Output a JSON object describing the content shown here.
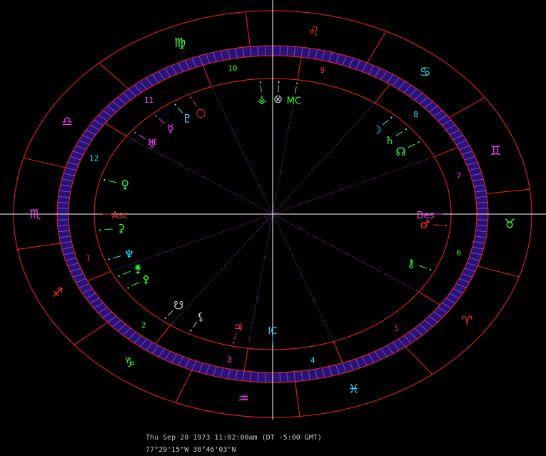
{
  "colors": {
    "background": "#000000",
    "ring": "#ff2020",
    "band": "#7a3cff",
    "axis": "#ffffff",
    "cusp": "#b030d0",
    "fire": "#ff3030",
    "earth": "#30ff30",
    "air": "#ff40ff",
    "water": "#30e0ff",
    "neutral": "#c0c0c0"
  },
  "zodiac": [
    {
      "name": "scorpio",
      "glyph": "♏",
      "angle": 180,
      "color": "#ff40ff"
    },
    {
      "name": "libra",
      "glyph": "♎",
      "angle": 150,
      "color": "#ff40ff"
    },
    {
      "name": "virgo",
      "glyph": "♍",
      "angle": 113,
      "color": "#30ff30"
    },
    {
      "name": "leo",
      "glyph": "♌",
      "angle": 80,
      "color": "#ff3030"
    },
    {
      "name": "cancer",
      "glyph": "♋",
      "angle": 50,
      "color": "#30e0ff"
    },
    {
      "name": "gemini",
      "glyph": "♊",
      "angle": 20,
      "color": "#ff40ff"
    },
    {
      "name": "taurus",
      "glyph": "♉",
      "angle": -3,
      "color": "#30ff30"
    },
    {
      "name": "aries",
      "glyph": "♈",
      "angle": -35,
      "color": "#ff3030"
    },
    {
      "name": "pisces",
      "glyph": "♓",
      "angle": -70,
      "color": "#30e0ff"
    },
    {
      "name": "aquarius",
      "glyph": "♒",
      "angle": -97,
      "color": "#ff40ff"
    },
    {
      "name": "capricorn",
      "glyph": "♑",
      "angle": -127,
      "color": "#30ff30"
    },
    {
      "name": "sagittarius",
      "glyph": "♐",
      "angle": -155,
      "color": "#ff3030"
    }
  ],
  "sign_boundaries": [
    164,
    132,
    96,
    64,
    35,
    7,
    -18,
    -52,
    -84,
    -112,
    -140,
    -170
  ],
  "house_cusps": [
    180,
    145,
    110,
    82,
    55,
    25,
    0,
    -35,
    -70,
    -98,
    -125,
    -155
  ],
  "house_numbers": [
    {
      "label": "1",
      "angle": -163,
      "color": "#ff3030"
    },
    {
      "label": "2",
      "angle": -132,
      "color": "#30ff30"
    },
    {
      "label": "3",
      "angle": -103,
      "color": "#ff40ff"
    },
    {
      "label": "4",
      "angle": -78,
      "color": "#30e0ff"
    },
    {
      "label": "5",
      "angle": -50,
      "color": "#ff3030"
    },
    {
      "label": "6",
      "angle": -15,
      "color": "#30ff30"
    },
    {
      "label": "7",
      "angle": 15,
      "color": "#ff40ff"
    },
    {
      "label": "8",
      "angle": 42,
      "color": "#30e0ff"
    },
    {
      "label": "9",
      "angle": 75,
      "color": "#ff3030"
    },
    {
      "label": "10",
      "angle": 102,
      "color": "#30ff30"
    },
    {
      "label": "11",
      "angle": 130,
      "color": "#ff40ff"
    },
    {
      "label": "12",
      "angle": 158,
      "color": "#30e0ff"
    }
  ],
  "points": [
    {
      "name": "mc",
      "glyph": "MC",
      "angle": 82,
      "color": "#30ff30"
    },
    {
      "name": "sun",
      "glyph": "⊗",
      "angle": 88,
      "color": "#c0c0c0"
    },
    {
      "name": "vesta",
      "glyph": "⚶",
      "angle": 94,
      "color": "#30ff30"
    },
    {
      "name": "moon",
      "glyph": "☽",
      "angle": 47,
      "color": "#30e0ff"
    },
    {
      "name": "saturn",
      "glyph": "♄",
      "angle": 40,
      "color": "#30ff30"
    },
    {
      "name": "node",
      "glyph": "☊",
      "angle": 33,
      "color": "#30ff30"
    },
    {
      "name": "pluto",
      "glyph": "♇",
      "angle": 124,
      "color": "#30e0ff"
    },
    {
      "name": "circle",
      "glyph": "○",
      "angle": 118,
      "color": "#ff3030"
    },
    {
      "name": "mercury",
      "glyph": "☿",
      "angle": 132,
      "color": "#ff40ff"
    },
    {
      "name": "uranus",
      "glyph": "♅",
      "angle": 142,
      "color": "#ff40ff"
    },
    {
      "name": "venus",
      "glyph": "♀",
      "angle": 165,
      "color": "#30ff30"
    },
    {
      "name": "asc",
      "glyph": "Asc",
      "angle": 180,
      "color": "#ff3030"
    },
    {
      "name": "ceres",
      "glyph": "⚳",
      "angle": -173,
      "color": "#30ff30"
    },
    {
      "name": "neptune",
      "glyph": "♆",
      "angle": -160,
      "color": "#30e0ff"
    },
    {
      "name": "juno",
      "glyph": "⚵",
      "angle": -152,
      "color": "#30ff30"
    },
    {
      "name": "pallas",
      "glyph": "⚴",
      "angle": -146,
      "color": "#30ff30"
    },
    {
      "name": "south-node",
      "glyph": "☋",
      "angle": -128,
      "color": "#c0c0c0"
    },
    {
      "name": "lilith",
      "glyph": "⚸",
      "angle": -118,
      "color": "#c0c0c0"
    },
    {
      "name": "jupiter",
      "glyph": "♃",
      "angle": -103,
      "color": "#ff3030"
    },
    {
      "name": "ic",
      "glyph": "IC",
      "angle": -90,
      "color": "#30e0ff"
    },
    {
      "name": "chiron",
      "glyph": "⚷",
      "angle": -25,
      "color": "#30ff30"
    },
    {
      "name": "mars",
      "glyph": "♂",
      "angle": -5,
      "color": "#ff3030"
    },
    {
      "name": "des",
      "glyph": "Des",
      "angle": 0,
      "color": "#ff40ff"
    }
  ],
  "status": {
    "date": "Thu Sep 20 1973 11:02:00am (DT -5:00 GMT)",
    "coords": "77°29'15\"W 38°46'03\"N"
  }
}
